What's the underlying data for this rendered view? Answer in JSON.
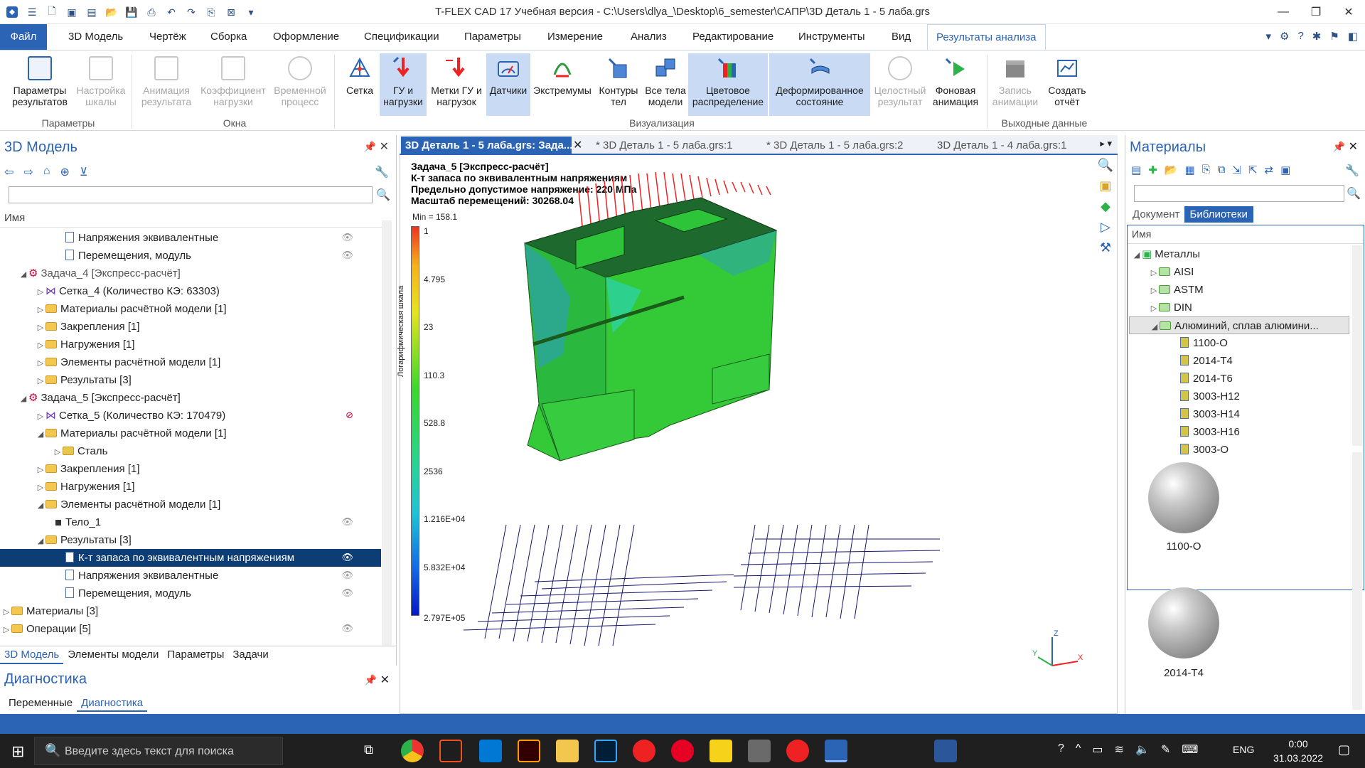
{
  "window": {
    "title": "T-FLEX CAD 17 Учебная версия - C:\\Users\\dlya_\\Desktop\\6_semester\\САПР\\3D Деталь 1 - 5 лаба.grs"
  },
  "ribbon_tabs": [
    "Файл",
    "3D Модель",
    "Чертёж",
    "Сборка",
    "Оформление",
    "Спецификации",
    "Параметры",
    "Измерение",
    "Анализ",
    "Редактирование",
    "Инструменты",
    "Вид",
    "Результаты анализа"
  ],
  "ribbon": {
    "buttons": [
      {
        "label1": "Параметры",
        "label2": "результатов"
      },
      {
        "label1": "Настройка",
        "label2": "шкалы"
      },
      {
        "label1": "Анимация",
        "label2": "результата"
      },
      {
        "label1": "Коэффициент",
        "label2": "нагрузки"
      },
      {
        "label1": "Временной",
        "label2": "процесс"
      },
      {
        "label1": "Сетка",
        "label2": ""
      },
      {
        "label1": "ГУ и",
        "label2": "нагрузки"
      },
      {
        "label1": "Метки ГУ и",
        "label2": "нагрузок"
      },
      {
        "label1": "Датчики",
        "label2": ""
      },
      {
        "label1": "Экстремумы",
        "label2": ""
      },
      {
        "label1": "Контуры",
        "label2": "тел"
      },
      {
        "label1": "Все тела",
        "label2": "модели"
      },
      {
        "label1": "Цветовое",
        "label2": "распределение"
      },
      {
        "label1": "Деформированное",
        "label2": "состояние"
      },
      {
        "label1": "Целостный",
        "label2": "результат"
      },
      {
        "label1": "Фоновая",
        "label2": "анимация"
      },
      {
        "label1": "Запись",
        "label2": "анимации"
      },
      {
        "label1": "Создать",
        "label2": "отчёт"
      }
    ],
    "groups": [
      "Параметры",
      "Окна",
      "Визуализация",
      "Выходные данные"
    ]
  },
  "left_panel": {
    "title": "3D Модель",
    "column_header": "Имя",
    "tree": [
      "Напряжения эквивалентные",
      "Перемещения, модуль",
      "Задача_4 [Экспресс-расчёт]",
      "Сетка_4 (Количество КЭ: 63303)",
      "Материалы расчётной модели [1]",
      "Закрепления [1]",
      "Нагружения [1]",
      "Элементы расчётной модели [1]",
      "Результаты [3]",
      "Задача_5 [Экспресс-расчёт]",
      "Сетка_5 (Количество КЭ: 170479)",
      "Материалы расчётной модели [1]",
      "Сталь",
      "Закрепления [1]",
      "Нагружения [1]",
      "Элементы расчётной модели [1]",
      "Тело_1",
      "Результаты [3]",
      "К-т запаса по эквивалентным напряжениям",
      "Напряжения эквивалентные",
      "Перемещения, модуль",
      "Материалы [3]",
      "Операции [5]"
    ],
    "bottom_tabs": [
      "3D Модель",
      "Элементы модели",
      "Параметры",
      "Задачи"
    ]
  },
  "diagnostics": {
    "title": "Диагностика",
    "tabs": [
      "Переменные",
      "Диагностика"
    ]
  },
  "doc_tabs": [
    "3D Деталь 1 - 5 лаба.grs: Зада...",
    "* 3D Деталь 1 - 5 лаба.grs:1",
    "* 3D Деталь 1 - 5 лаба.grs:2",
    "3D Деталь 1 - 4 лаба.grs:1"
  ],
  "viewport": {
    "info_lines": [
      "Задача_5 [Экспресс-расчёт]",
      "К-т запаса по эквивалентным напряжениям",
      "Предельно допустимое напряжение: 220 МПа",
      "Масштаб перемещений: 30268.04"
    ],
    "min_label": "Min = 158.1",
    "scale_title": "Логарифмическая шкала",
    "scale_ticks": [
      "1",
      "4.795",
      "23",
      "110.3",
      "528.8",
      "2536",
      "1.216E+04",
      "5.832E+04",
      "2.797E+05"
    ],
    "axes": {
      "z": "Z",
      "y": "Y",
      "x": "X"
    }
  },
  "right_panel": {
    "title": "Материалы",
    "tabs": [
      "Документ",
      "Библиотеки"
    ],
    "column_header": "Имя",
    "tree": [
      "Металлы",
      "AISI",
      "ASTM",
      "DIN",
      "Алюминий, сплав алюмини...",
      "1100-O",
      "2014-T4",
      "2014-T6",
      "3003-H12",
      "3003-H14",
      "3003-H16",
      "3003-O"
    ],
    "previews": [
      "1100-O",
      "2014-T4"
    ]
  },
  "taskbar": {
    "search_placeholder": "Введите здесь текст для поиска",
    "lang": "ENG",
    "time": "0:00",
    "date": "31.03.2022"
  }
}
